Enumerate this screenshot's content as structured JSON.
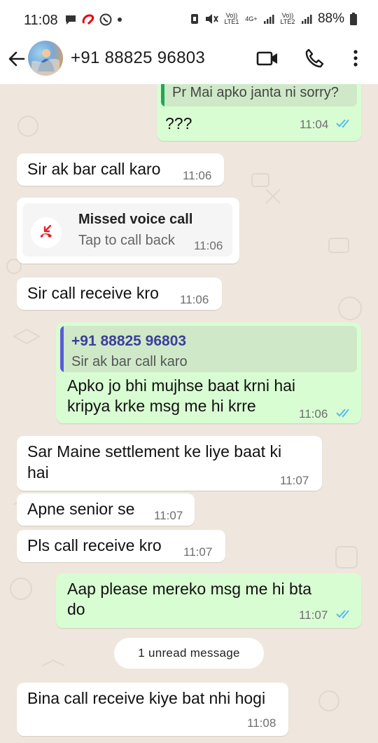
{
  "status_bar": {
    "time": "11:08",
    "volte1": "Vo)) LTE1",
    "network": "4G+",
    "volte2": "Vo)) LTE2",
    "battery": "88%"
  },
  "header": {
    "contact_name": "+91 88825 96803"
  },
  "messages": {
    "m1": {
      "quoted_text": "Pr Mai apko janta ni sorry?",
      "text": "???",
      "time": "11:04"
    },
    "m2": {
      "text": "Sir ak bar call karo",
      "time": "11:06"
    },
    "m3": {
      "title": "Missed voice call",
      "subtitle": "Tap to call back",
      "time": "11:06"
    },
    "m4": {
      "text": "Sir call receive kro",
      "time": "11:06"
    },
    "m5": {
      "quoted_name": "+91 88825 96803",
      "quoted_text": "Sir ak bar call karo",
      "line1": "Apko jo bhi mujhse baat krni hai",
      "line2": "kripya krke msg me hi krre",
      "time": "11:06"
    },
    "m6": {
      "line1": "Sar Maine settlement ke liye baat ki",
      "line2": "hai",
      "time": "11:07"
    },
    "m7": {
      "text": "Apne senior se",
      "time": "11:07"
    },
    "m8": {
      "text": "Pls call receive kro",
      "time": "11:07"
    },
    "m9": {
      "line1": "Aap please mereko msg me hi bta",
      "line2": "do",
      "time": "11:07"
    },
    "unread": "1 unread message",
    "m10": {
      "text": "Bina call receive kiye bat nhi hogi",
      "time": "11:08"
    }
  },
  "colors": {
    "incoming_bubble": "#ffffff",
    "outgoing_bubble": "#d9fdd3",
    "read_ticks": "#53bdeb",
    "missed_call": "#e5202b",
    "chat_background": "#efe7dd"
  }
}
